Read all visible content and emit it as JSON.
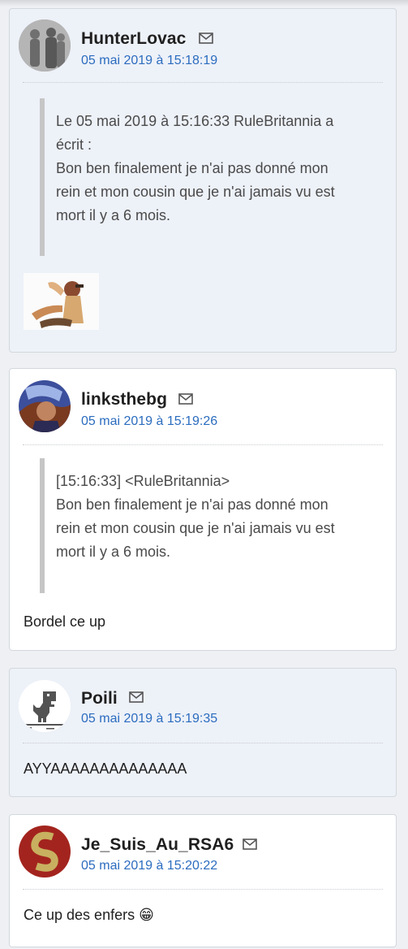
{
  "posts": [
    {
      "username": "HunterLovac",
      "date": "05 mai 2019 à 15:18:19",
      "quote_lines": [
        "Le 05 mai 2019 à 15:16:33 RuleBritannia a",
        "écrit :",
        "Bon ben finalement je n'ai pas donné mon",
        "rein et mon cousin que je n'ai jamais vu est",
        "mort il y a 6 mois."
      ],
      "has_image": true
    },
    {
      "username": "linksthebg",
      "date": "05 mai 2019 à 15:19:26",
      "quote_lines": [
        "[15:16:33] <RuleBritannia>",
        "Bon ben finalement je n'ai pas donné mon",
        "rein et mon cousin que je n'ai jamais vu est",
        "mort il y a 6 mois."
      ],
      "text": "Bordel ce up"
    },
    {
      "username": "Poili",
      "date": "05 mai 2019 à 15:19:35",
      "text": "AYYAAAAAAAAAAAAAA"
    },
    {
      "username": "Je_Suis_Au_RSA6",
      "date": "05 mai 2019 à 15:20:22",
      "text": "Ce up des enfers",
      "emoji": "😁"
    }
  ],
  "icons": {
    "message": "mail-icon",
    "post_image": "sticker-image"
  },
  "colors": {
    "date_link": "#2b6cbf",
    "alt_post_bg": "#edf1f8",
    "quote_bar": "#c6c6c6"
  }
}
